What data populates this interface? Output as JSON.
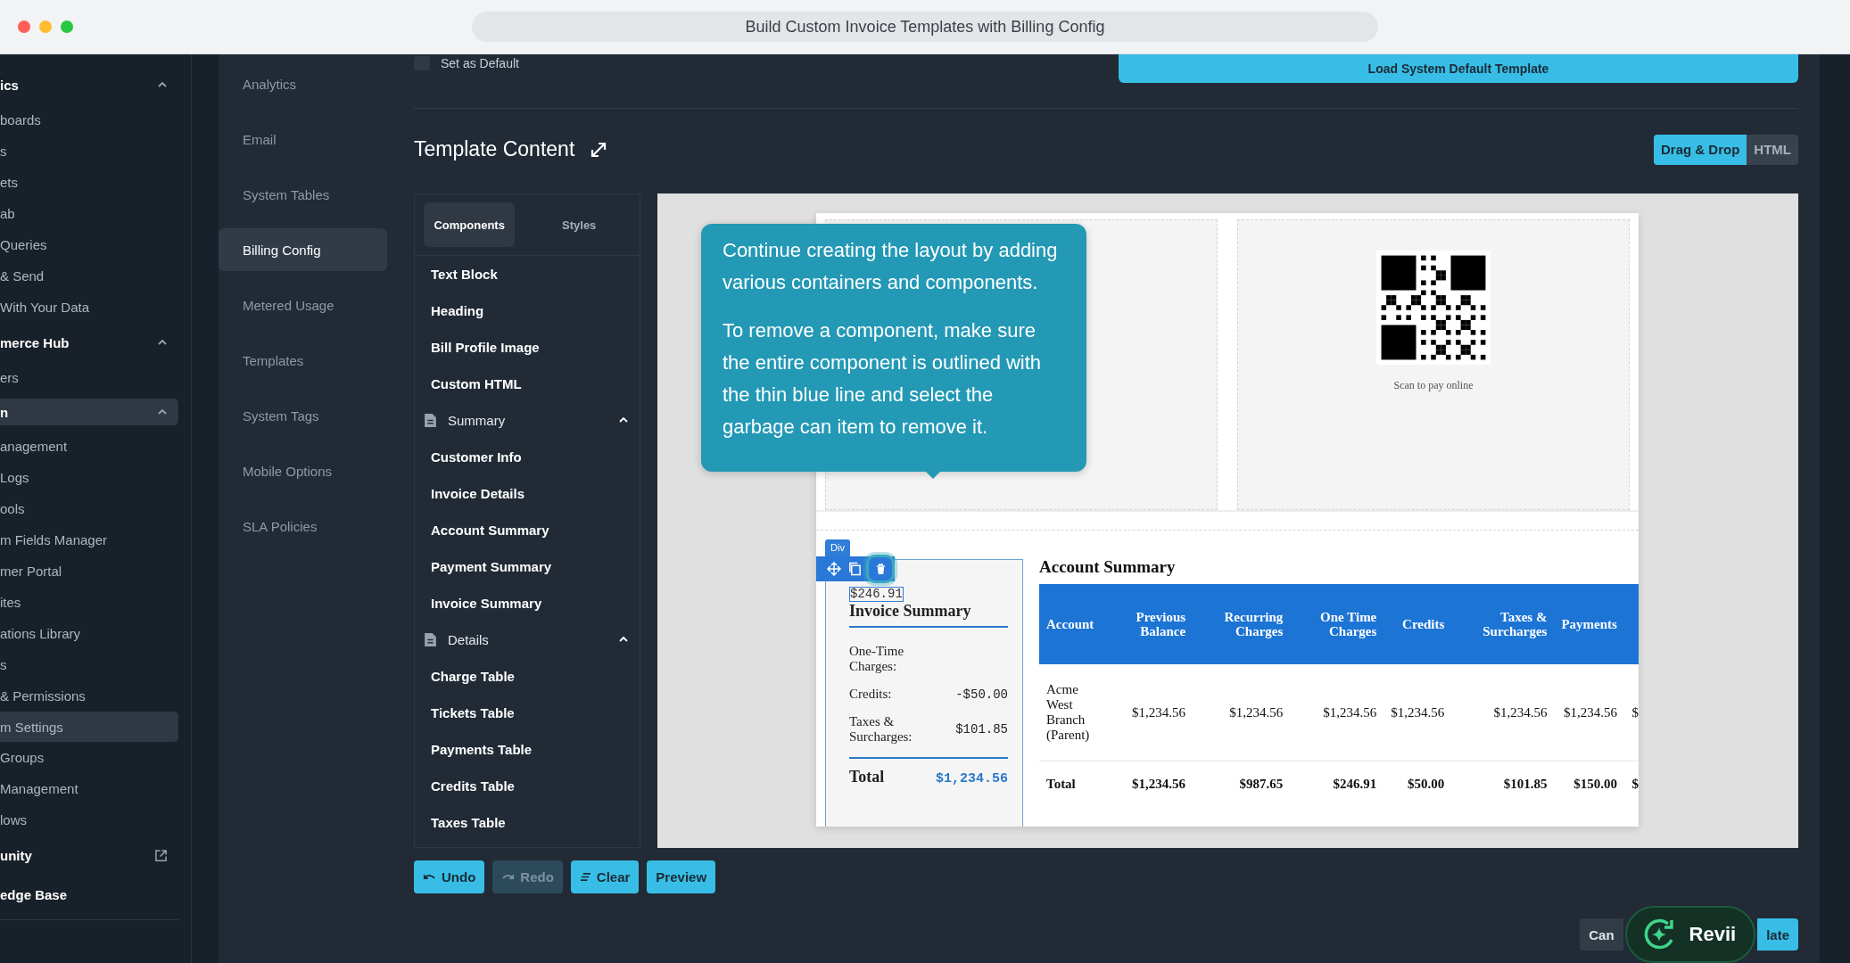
{
  "window": {
    "title": "Build Custom Invoice Templates with Billing Config"
  },
  "sidebar": {
    "items": [
      {
        "kind": "header",
        "label": "ics",
        "expanded": true,
        "selected": false
      },
      {
        "kind": "item",
        "label": "boards",
        "selected": false
      },
      {
        "kind": "item",
        "label": "s",
        "selected": false
      },
      {
        "kind": "item",
        "label": "ets",
        "selected": false
      },
      {
        "kind": "item",
        "label": "ab",
        "selected": false
      },
      {
        "kind": "item",
        "label": "Queries",
        "selected": false
      },
      {
        "kind": "item",
        "label": "& Send",
        "selected": false
      },
      {
        "kind": "item",
        "label": "With Your Data",
        "selected": false
      },
      {
        "kind": "header",
        "label": "merce Hub",
        "expanded": true,
        "selected": false
      },
      {
        "kind": "item",
        "label": "ers",
        "selected": false
      },
      {
        "kind": "header",
        "label": "n",
        "expanded": true,
        "selected": true
      },
      {
        "kind": "item",
        "label": "anagement",
        "selected": false
      },
      {
        "kind": "item",
        "label": "Logs",
        "selected": false
      },
      {
        "kind": "item",
        "label": "ools",
        "selected": false
      },
      {
        "kind": "item",
        "label": "m Fields Manager",
        "selected": false
      },
      {
        "kind": "item",
        "label": "mer Portal",
        "selected": false
      },
      {
        "kind": "item",
        "label": "ites",
        "selected": false
      },
      {
        "kind": "item",
        "label": "ations Library",
        "selected": false
      },
      {
        "kind": "item",
        "label": "s",
        "selected": false
      },
      {
        "kind": "item",
        "label": "& Permissions",
        "selected": false
      },
      {
        "kind": "item",
        "label": "m Settings",
        "selected": true
      },
      {
        "kind": "item",
        "label": "Groups",
        "selected": false
      },
      {
        "kind": "item",
        "label": "Management",
        "selected": false
      },
      {
        "kind": "item",
        "label": "lows",
        "selected": false
      },
      {
        "kind": "link",
        "label": "unity",
        "selected": false
      },
      {
        "kind": "link_plain",
        "label": "edge Base",
        "selected": false
      }
    ]
  },
  "settings_nav": {
    "items": [
      {
        "label": "Analytics",
        "selected": false
      },
      {
        "label": "Email",
        "selected": false
      },
      {
        "label": "System Tables",
        "selected": false
      },
      {
        "label": "Billing Config",
        "selected": true
      },
      {
        "label": "Metered Usage",
        "selected": false
      },
      {
        "label": "Templates",
        "selected": false
      },
      {
        "label": "System Tags",
        "selected": false
      },
      {
        "label": "Mobile Options",
        "selected": false
      },
      {
        "label": "SLA Policies",
        "selected": false
      }
    ]
  },
  "top": {
    "default_checkbox": {
      "label": "Set as Default",
      "checked": false
    },
    "load_button": "Load System Default Template"
  },
  "template_content": {
    "title": "Template Content",
    "modes": [
      {
        "label": "Drag & Drop",
        "selected": true
      },
      {
        "label": "HTML",
        "selected": false
      }
    ]
  },
  "component_panel": {
    "tabs": [
      {
        "label": "Components",
        "selected": true
      },
      {
        "label": "Styles",
        "selected": false
      }
    ],
    "items": [
      {
        "kind": "item",
        "label": "Text Block"
      },
      {
        "kind": "item",
        "label": "Heading"
      },
      {
        "kind": "item",
        "label": "Bill Profile Image"
      },
      {
        "kind": "item",
        "label": "Custom HTML"
      },
      {
        "kind": "group",
        "label": "Summary",
        "expanded": true
      },
      {
        "kind": "item",
        "label": "Customer Info"
      },
      {
        "kind": "item",
        "label": "Invoice Details"
      },
      {
        "kind": "item",
        "label": "Account Summary"
      },
      {
        "kind": "item",
        "label": "Payment Summary"
      },
      {
        "kind": "item",
        "label": "Invoice Summary"
      },
      {
        "kind": "group",
        "label": "Details",
        "expanded": true
      },
      {
        "kind": "item",
        "label": "Charge Table"
      },
      {
        "kind": "item",
        "label": "Tickets Table"
      },
      {
        "kind": "item",
        "label": "Payments Table"
      },
      {
        "kind": "item",
        "label": "Credits Table"
      },
      {
        "kind": "item",
        "label": "Taxes Table"
      }
    ]
  },
  "canvas": {
    "qr_caption": "Scan to pay online",
    "selection": {
      "tag": "Div",
      "selected_text": "$246.91"
    },
    "invoice_summary": {
      "title": "Invoice Summary",
      "rows": [
        {
          "label": "One-Time Charges:"
        },
        {
          "label": "Credits:",
          "value": "-$50.00"
        },
        {
          "label": "Taxes & Surcharges:",
          "value": "$101.85"
        }
      ],
      "total": {
        "label": "Total",
        "value": "$1,234.56"
      }
    },
    "account_summary": {
      "title": "Account Summary",
      "columns": [
        "Account",
        "Previous Balance",
        "Recurring Charges",
        "One Time Charges",
        "Credits",
        "Taxes & Surcharges",
        "Payments"
      ],
      "rows": [
        [
          "Acme West Branch (Parent)",
          "$1,234.56",
          "$1,234.56",
          "$1,234.56",
          "$1,234.56",
          "$1,234.56",
          "$1,234.56",
          "$"
        ],
        [
          "Total",
          "$1,234.56",
          "$987.65",
          "$246.91",
          "$50.00",
          "$101.85",
          "$150.00",
          "$"
        ]
      ]
    }
  },
  "tooltip": {
    "paragraphs": [
      "Continue creating the layout by adding various containers and components.",
      "To remove a component, make sure the entire component is outlined with the thin blue line and select the garbage can item to remove it."
    ]
  },
  "actions": [
    {
      "kind": "undo",
      "label": "Undo",
      "disabled": false
    },
    {
      "kind": "redo",
      "label": "Redo",
      "disabled": true
    },
    {
      "kind": "clear",
      "label": "Clear",
      "disabled": false
    },
    {
      "kind": "plain",
      "label": "Preview",
      "disabled": false
    }
  ],
  "footer": {
    "buttons": [
      {
        "kind": "secondary",
        "label": "Can"
      },
      {
        "kind": "primary",
        "label": "late"
      }
    ],
    "assistant": {
      "label": "Revii"
    }
  }
}
